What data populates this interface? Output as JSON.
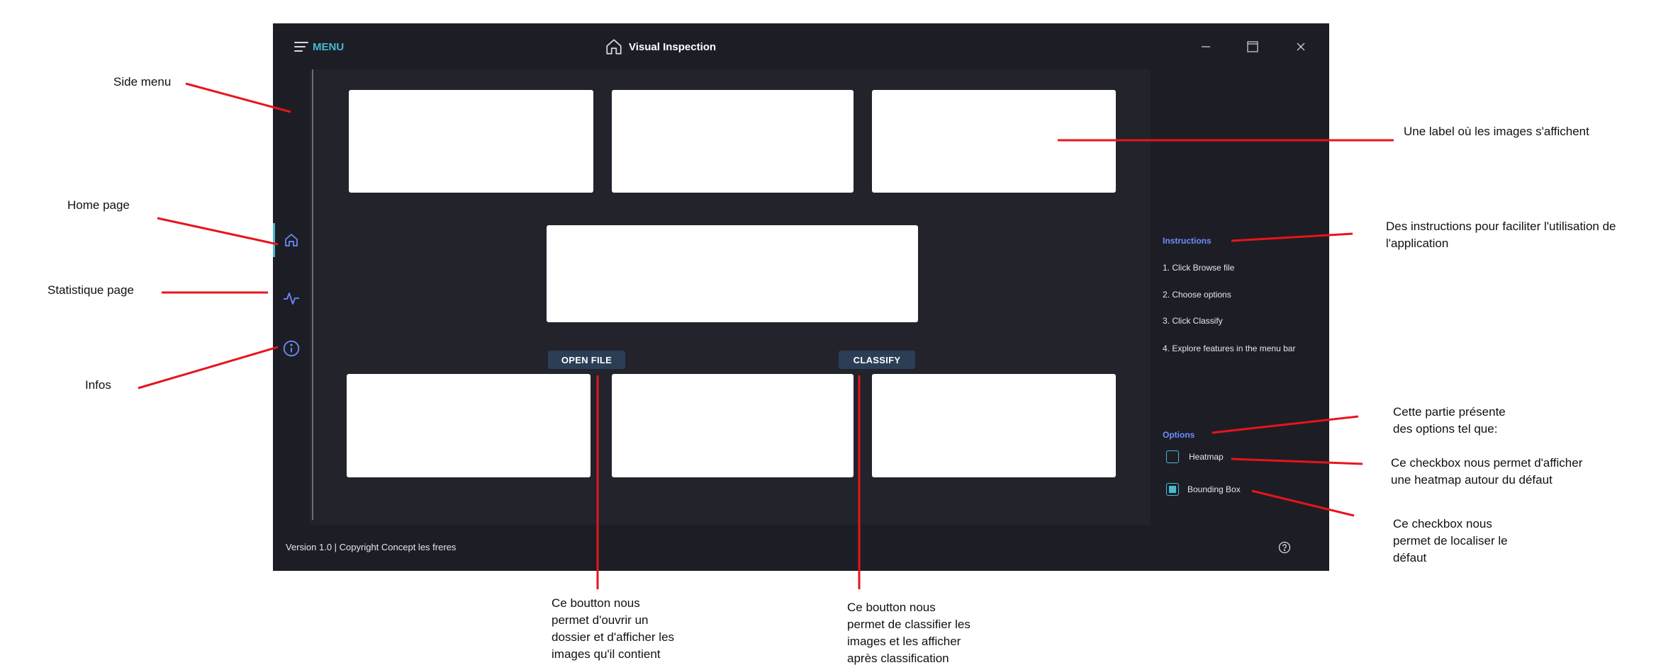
{
  "window": {
    "menu_label": "MENU",
    "title": "Visual Inspection"
  },
  "main": {
    "open_file_label": "OPEN FILE",
    "classify_label": "CLASSIFY"
  },
  "instructions": {
    "title": "Instructions",
    "steps": [
      "1. Click Browse file",
      "2. Choose options",
      "3. Click Classify",
      "4. Explore features in the menu bar"
    ]
  },
  "options": {
    "title": "Options",
    "heatmap_label": "Heatmap",
    "heatmap_checked": false,
    "bounding_box_label": "Bounding Box",
    "bounding_box_checked": true
  },
  "footer": {
    "version_text": "Version 1.0 | Copyright Concept les freres"
  },
  "sidebar": {
    "icons": [
      "home-icon",
      "activity-icon",
      "info-icon"
    ]
  },
  "annotations": {
    "side_menu": "Side menu",
    "home_page": "Home page",
    "statistique_page": "Statistique page",
    "infos": "Infos",
    "image_label": "Une label où les images s'affichent",
    "instructions_line1": "Des instructions pour faciliter l'utilisation de",
    "instructions_line2": "l'application",
    "options_line1": "Cette partie présente",
    "options_line2": "des options tel que:",
    "heatmap_line1": "Ce checkbox nous permet d'afficher",
    "heatmap_line2": "une heatmap autour du défaut",
    "bbox_line1": "Ce checkbox nous",
    "bbox_line2": "permet de localiser le",
    "bbox_line3": "défaut",
    "open_line1": "Ce boutton nous",
    "open_line2": "permet d'ouvrir un",
    "open_line3": "dossier et d'afficher les",
    "open_line4": "images qu'il contient",
    "classify_line1": "Ce boutton nous",
    "classify_line2": "permet de classifier les",
    "classify_line3": "images et les afficher",
    "classify_line4": "après classification"
  },
  "colors": {
    "accent": "#46b9d1",
    "section_title": "#6e8cff",
    "annotation_line": "#e8141c",
    "window_bg": "#22232b"
  }
}
